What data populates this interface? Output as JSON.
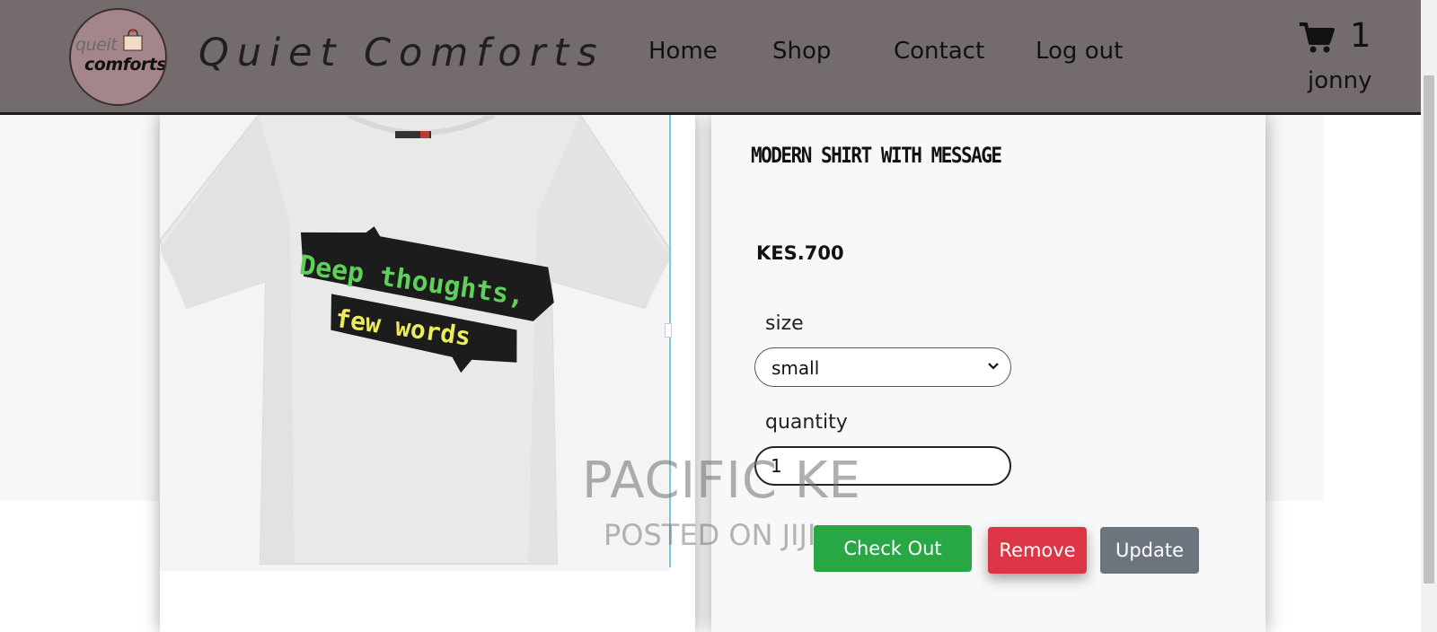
{
  "header": {
    "brand": "Quiet Comforts",
    "logo": {
      "line1": "queit",
      "line2": "comforts"
    },
    "nav": [
      {
        "label": "Home"
      },
      {
        "label": "Shop"
      },
      {
        "label": "Contact"
      },
      {
        "label": "Log out"
      }
    ],
    "cart_count": "1",
    "username": "jonny",
    "background_color": "#736b6c"
  },
  "product": {
    "name": "MODERN SHIRT WITH MESSAGE",
    "price": "KES.700",
    "image_alt": "white t-shirt",
    "shirt_print_line1": "Deep thoughts,",
    "shirt_print_line2": "few words",
    "size_label": "size",
    "size_value": "small",
    "quantity_label": "quantity",
    "quantity_value": "1"
  },
  "buttons": {
    "checkout": "Check Out",
    "remove": "Remove",
    "update": "Update"
  },
  "watermark": {
    "main": "PACIFIC KE",
    "sub": "POSTED ON JIJI"
  },
  "colors": {
    "checkout": "#28a745",
    "remove": "#dc3545",
    "update": "#6c757d"
  }
}
